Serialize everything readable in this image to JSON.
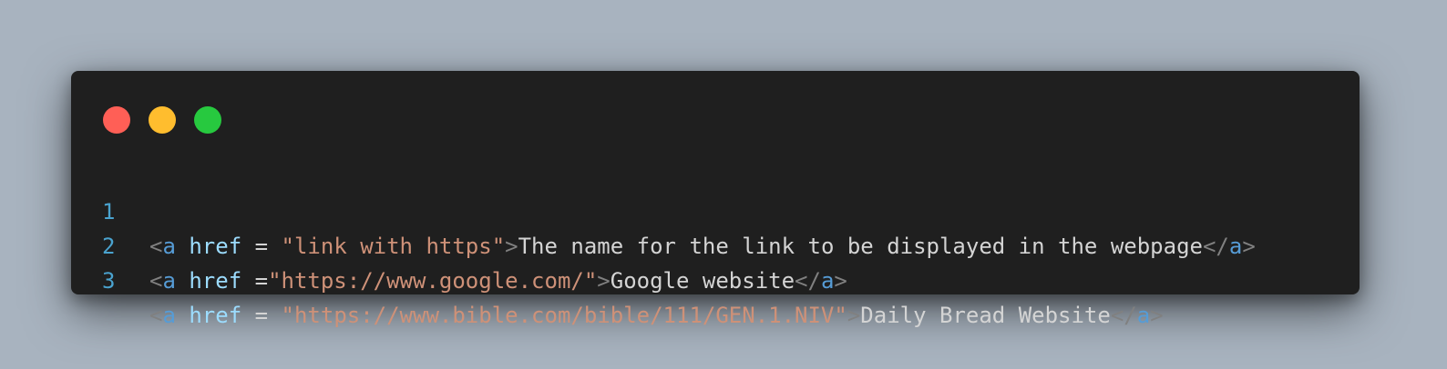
{
  "window": {
    "controls": [
      {
        "name": "close",
        "color": "#ff5f56"
      },
      {
        "name": "minimize",
        "color": "#ffbd2e"
      },
      {
        "name": "maximize",
        "color": "#27c93f"
      }
    ]
  },
  "code": {
    "lines": [
      {
        "number": "1",
        "open_bracket": "<",
        "tag": "a",
        "attr": " href",
        "op": " = ",
        "value": "\"link with https\"",
        "close_bracket": ">",
        "text": "The name for the link to be displayed in the webpage",
        "end_open": "</",
        "end_tag": "a",
        "end_close": ">"
      },
      {
        "number": "2",
        "open_bracket": "<",
        "tag": "a",
        "attr": " href",
        "op": " =",
        "value": "\"https://www.google.com/\"",
        "close_bracket": ">",
        "text": "Google website",
        "end_open": "</",
        "end_tag": "a",
        "end_close": ">"
      },
      {
        "number": "3",
        "open_bracket": "<",
        "tag": "a",
        "attr": " href",
        "op": " = ",
        "value": "\"https://www.bible.com/bible/111/GEN.1.NIV\"",
        "close_bracket": ">",
        "text": "Daily Bread Website",
        "end_open": "</",
        "end_tag": "a",
        "end_close": ">"
      }
    ]
  }
}
